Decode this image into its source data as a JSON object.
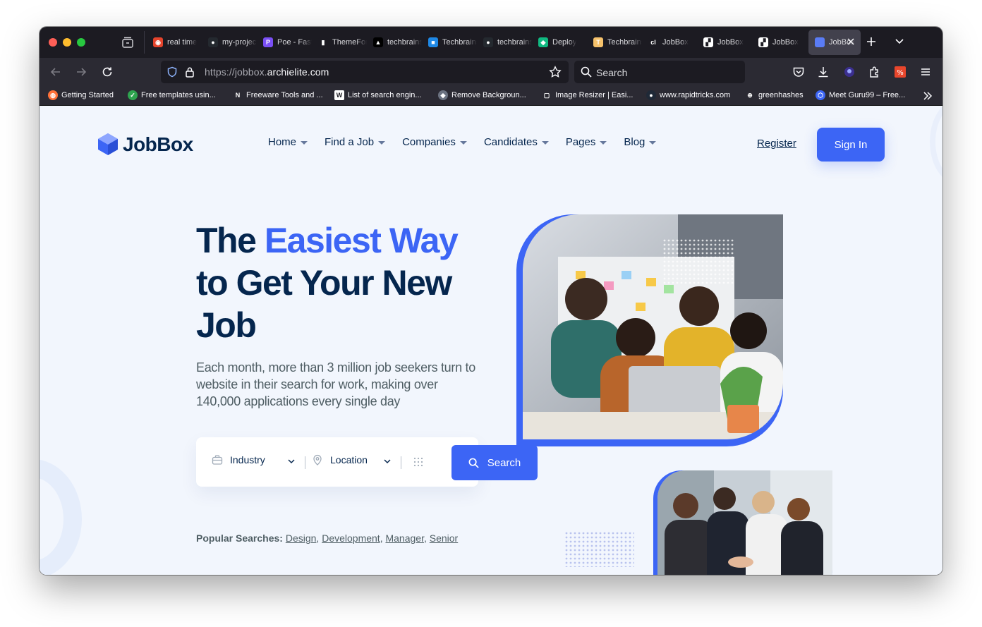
{
  "browser": {
    "tabs": [
      {
        "label": "real time",
        "color": "#e5442c",
        "glyph": "◉"
      },
      {
        "label": "my-project",
        "color": "#24292f",
        "glyph": "●"
      },
      {
        "label": "Poe - Fast",
        "color": "#7a4ff5",
        "glyph": "P"
      },
      {
        "label": "ThemeForest",
        "color": "#1c1b22",
        "glyph": "▮"
      },
      {
        "label": "techbrains",
        "color": "#000000",
        "glyph": "▲"
      },
      {
        "label": "Techbrains",
        "color": "#1e88e5",
        "glyph": "■"
      },
      {
        "label": "techbrains",
        "color": "#24292f",
        "glyph": "●"
      },
      {
        "label": "Deploy",
        "color": "#10b981",
        "glyph": "◆"
      },
      {
        "label": "Techbrains",
        "color": "#f6c26b",
        "glyph": "T"
      },
      {
        "label": "JobBox",
        "color": "#1c1b22",
        "glyph": "cl"
      },
      {
        "label": "JobBox",
        "color": "#ffffff",
        "glyph": "▞"
      },
      {
        "label": "JobBox",
        "color": "#ffffff",
        "glyph": "▞"
      }
    ],
    "active_tab": {
      "label": "JobBox",
      "color": "#5a7cf5"
    },
    "url_prefix": "https://jobbox.",
    "url_domain": "archielite.com",
    "search_placeholder": "Search",
    "bookmarks": [
      {
        "label": "Getting Started",
        "color": "#ff7139",
        "glyph": "◍"
      },
      {
        "label": "Free templates usin...",
        "color": "#2ea44f",
        "glyph": "✓"
      },
      {
        "label": "Freeware Tools and ...",
        "color": "#2b2a33",
        "glyph": "N"
      },
      {
        "label": "List of search engin...",
        "color": "#ffffff",
        "glyph": "W"
      },
      {
        "label": "Remove Backgroun...",
        "color": "#6b7280",
        "glyph": "◆"
      },
      {
        "label": "Image Resizer | Easi...",
        "color": "#2b2a33",
        "glyph": "▢"
      },
      {
        "label": "www.rapidtricks.com",
        "color": "#1f2937",
        "glyph": "●"
      },
      {
        "label": "greenhashes",
        "color": "#2b2a33",
        "glyph": "⊕"
      },
      {
        "label": "Meet Guru99 – Free...",
        "color": "#3c65f5",
        "glyph": "⬡"
      }
    ]
  },
  "site": {
    "logo": "JobBox",
    "nav": [
      "Home",
      "Find a Job",
      "Companies",
      "Candidates",
      "Pages",
      "Blog"
    ],
    "register": "Register",
    "signin": "Sign In",
    "hero": {
      "title_plain": "The",
      "title_accent": "Easiest Way",
      "title_rest": "to Get Your New Job",
      "subtitle": "Each month, more than 3 million job seekers turn to website in their search for work, making over 140,000 applications every single day"
    },
    "search": {
      "industry": "Industry",
      "location": "Location",
      "button": "Search"
    },
    "popular": {
      "label": "Popular Searches:",
      "tags": [
        "Design",
        "Development",
        "Manager",
        "Senior"
      ]
    }
  },
  "colors": {
    "brand": "#3c65f5",
    "heading": "#05264e",
    "text": "#4f5e64",
    "page_bg": "#f2f6fd"
  }
}
